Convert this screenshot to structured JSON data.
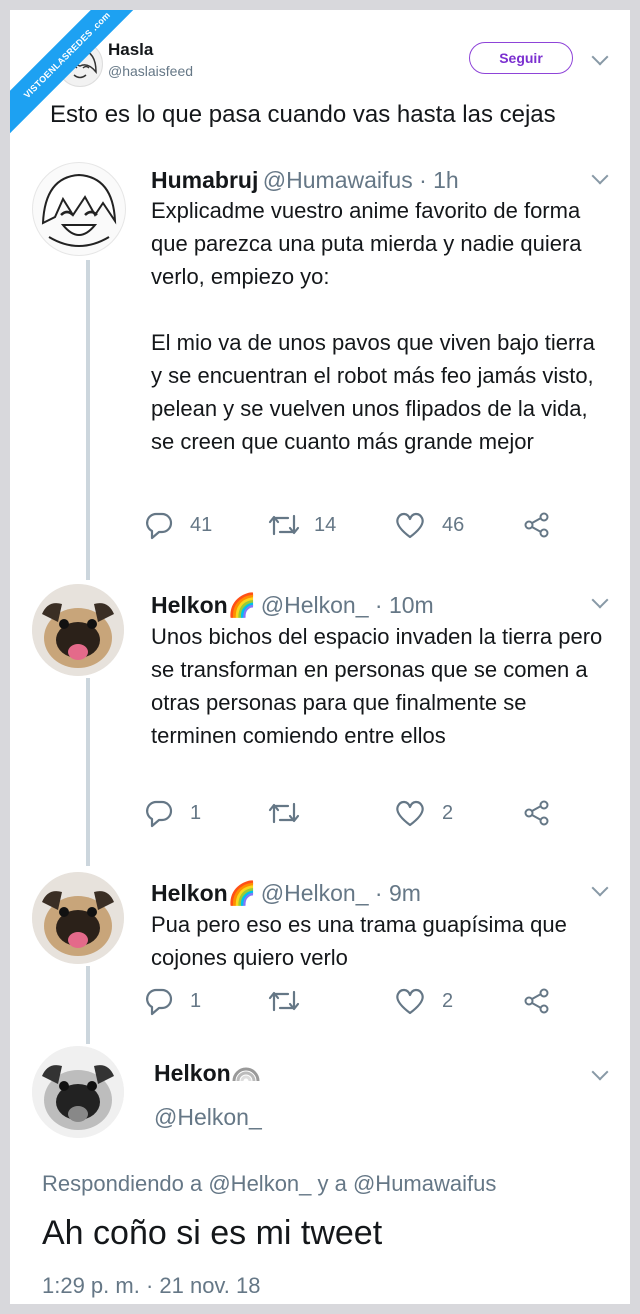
{
  "watermark": "VISTOENLASREDES .com",
  "header": {
    "name": "Hasla",
    "handle": "@haslaisfeed",
    "follow_label": "Seguir",
    "text": "Esto es lo que pasa cuando vas hasta las cejas"
  },
  "tweets": [
    {
      "name": "Humabruj",
      "emoji": "",
      "meta": "@Humawaifus · 1h",
      "body": "Explicadme vuestro anime favorito de forma que parezca una puta mierda y nadie quiera verlo, empiezo yo:\n\nEl mio va de unos pavos que viven bajo tierra y se encuentran el robot más feo jamás visto, pelean y se vuelven unos flipados de la vida, se creen que cuanto más grande mejor",
      "replies": "41",
      "retweets": "14",
      "likes": "46"
    },
    {
      "name": "Helkon",
      "emoji": "🌈",
      "meta": "@Helkon_ · 10m",
      "body": "Unos bichos del espacio invaden la tierra pero se transforman en personas que se comen a otras personas para que finalmente se terminen comiendo entre ellos",
      "replies": "1",
      "retweets": "",
      "likes": "2"
    },
    {
      "name": "Helkon",
      "emoji": "🌈",
      "meta": "@Helkon_ · 9m",
      "body": "Pua pero eso es una trama guapísima que cojones quiero verlo",
      "replies": "1",
      "retweets": "",
      "likes": "2"
    }
  ],
  "focused": {
    "name": "Helkon",
    "handle": "@Helkon_",
    "replying": "Respondiendo a @Helkon_ y a @Humawaifus",
    "text": "Ah coño si es mi tweet",
    "time": "1:29 p. m. · 21 nov. 18"
  },
  "colors": {
    "accent": "#7b2fd0",
    "muted": "#657786",
    "watermark": "#1da1f2"
  },
  "icons": [
    "reply-icon",
    "retweet-icon",
    "like-icon",
    "share-icon",
    "chevron-down-icon",
    "rainbow-icon"
  ]
}
